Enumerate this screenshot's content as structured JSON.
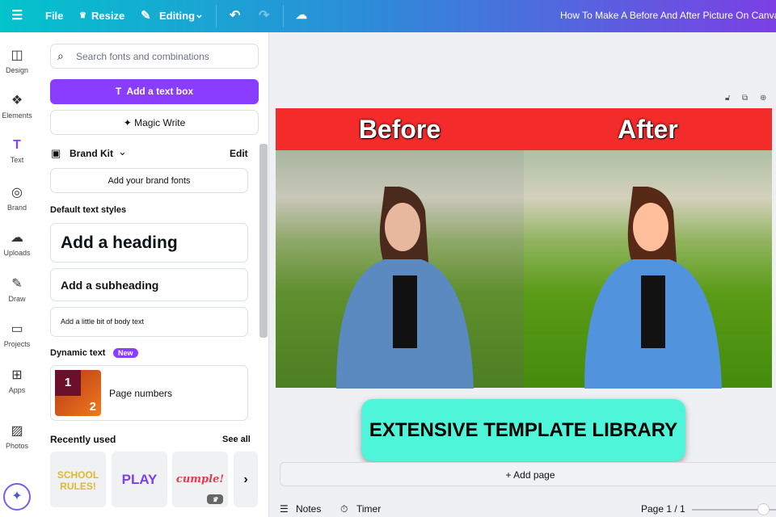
{
  "topbar": {
    "file": "File",
    "resize": "Resize",
    "editing": "Editing",
    "title": "How To Make A Before And After Picture On Canva"
  },
  "rail": [
    {
      "label": "Design",
      "icon": "layout-icon"
    },
    {
      "label": "Elements",
      "icon": "shapes-icon"
    },
    {
      "label": "Text",
      "icon": "text-icon"
    },
    {
      "label": "Brand",
      "icon": "brand-icon"
    },
    {
      "label": "Uploads",
      "icon": "cloud-upload-icon"
    },
    {
      "label": "Draw",
      "icon": "pen-icon"
    },
    {
      "label": "Projects",
      "icon": "folder-icon"
    },
    {
      "label": "Apps",
      "icon": "apps-icon"
    },
    {
      "label": "Photos",
      "icon": "image-icon"
    }
  ],
  "panel": {
    "search_placeholder": "Search fonts and combinations",
    "add_text_box": "Add a text box",
    "magic_write": "Magic Write",
    "brand_kit": "Brand Kit",
    "edit": "Edit",
    "add_brand_fonts": "Add your brand fonts",
    "default_styles": "Default text styles",
    "heading": "Add a heading",
    "subheading": "Add a subheading",
    "body": "Add a little bit of body text",
    "dynamic_text": "Dynamic text",
    "new_badge": "New",
    "page_numbers": "Page numbers",
    "pn_1": "1",
    "pn_2": "2",
    "recently_used": "Recently used",
    "see_all": "See all",
    "recent": [
      "SCHOOL RULES!",
      "PLAY",
      "cumple!"
    ]
  },
  "canvas": {
    "before": "Before",
    "after": "After",
    "banner": "EXTENSIVE TEMPLATE LIBRARY",
    "add_page": "+ Add page"
  },
  "bottom": {
    "notes": "Notes",
    "timer": "Timer",
    "page": "Page 1 / 1",
    "zoom_fraction": 0.85
  },
  "colors": {
    "accent": "#8b3dff",
    "header_red": "#f42b2b",
    "banner": "#4ff5d8"
  }
}
